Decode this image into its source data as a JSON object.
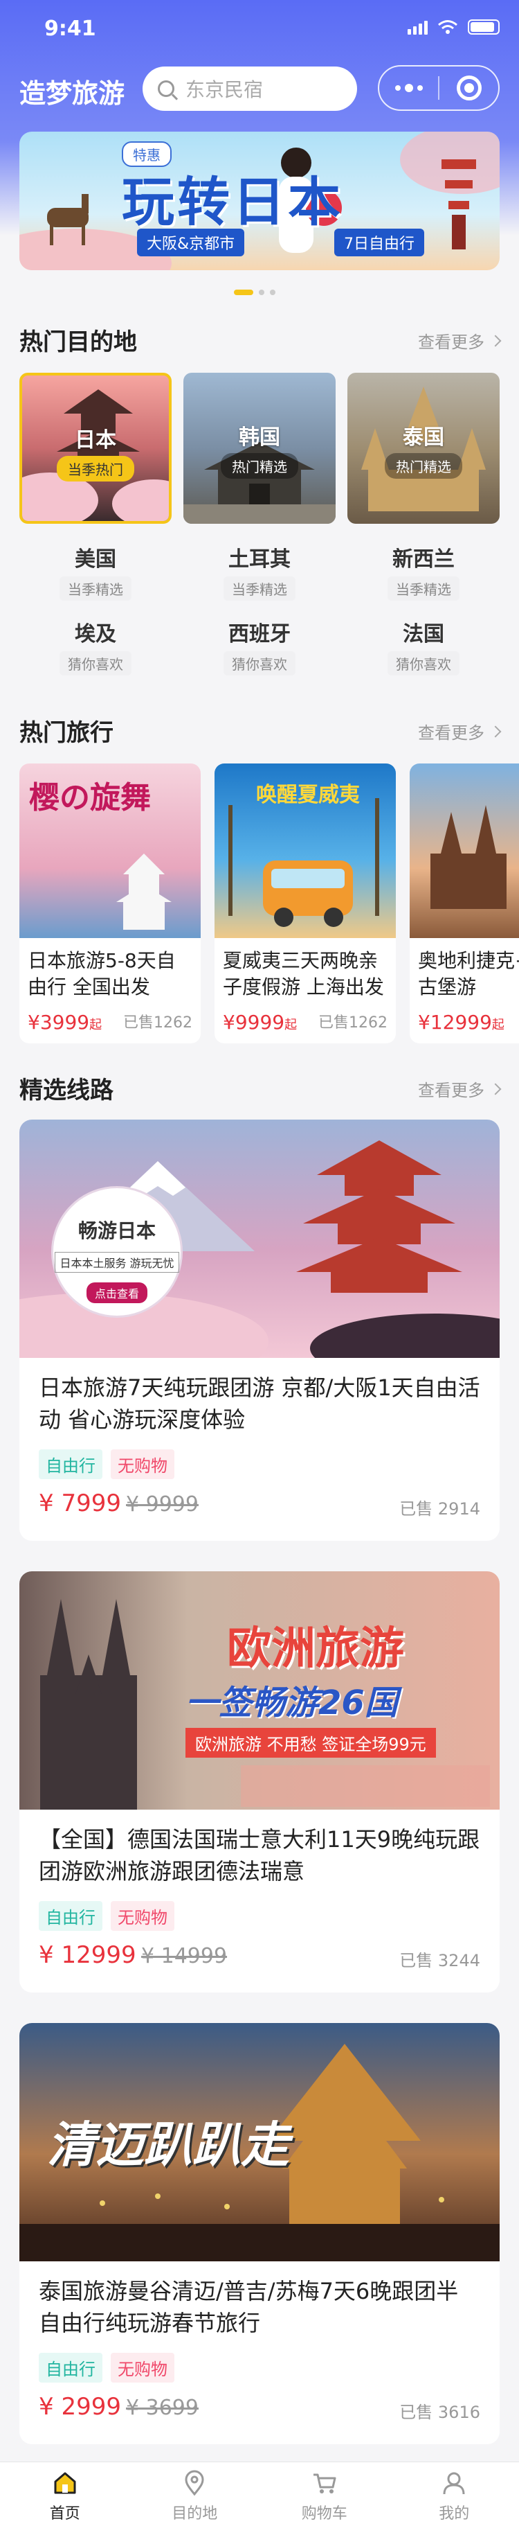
{
  "status": {
    "time": "9:41"
  },
  "header": {
    "brand": "造梦旅游",
    "search_placeholder": "东京民宿"
  },
  "banner": {
    "tag": "特惠",
    "title": "玩转日本",
    "pill_left": "大阪&京都市",
    "pill_right": "7日自由行"
  },
  "hot_dest": {
    "title": "热门目的地",
    "more": "查看更多",
    "featured": [
      {
        "name": "日本",
        "badge": "当季热门"
      },
      {
        "name": "韩国",
        "badge": "热门精选"
      },
      {
        "name": "泰国",
        "badge": "热门精选"
      }
    ],
    "grid": [
      {
        "name": "美国",
        "sub": "当季精选"
      },
      {
        "name": "土耳其",
        "sub": "当季精选"
      },
      {
        "name": "新西兰",
        "sub": "当季精选"
      },
      {
        "name": "埃及",
        "sub": "猜你喜欢"
      },
      {
        "name": "西班牙",
        "sub": "猜你喜欢"
      },
      {
        "name": "法国",
        "sub": "猜你喜欢"
      }
    ]
  },
  "hot_trips": {
    "title": "热门旅行",
    "more": "查看更多",
    "items": [
      {
        "title": "日本旅游5-8天自由行 全国出发",
        "price": "¥3999",
        "unit": "起",
        "sold": "已售1262",
        "art_title": "樱の旋舞"
      },
      {
        "title": "夏威夷三天两晚亲子度假游 上海出发",
        "price": "¥9999",
        "unit": "起",
        "sold": "已售1262",
        "art_title": "唤醒夏威夷"
      },
      {
        "title": "奥地利捷克+欧洲古堡游",
        "price": "¥12999",
        "unit": "起",
        "sold": ""
      }
    ]
  },
  "routes": {
    "title": "精选线路",
    "more": "查看更多",
    "items": [
      {
        "title": "日本旅游7天纯玩跟团游 京都/大阪1天自由活动 省心游玩深度体验",
        "tags": [
          "自由行",
          "无购物"
        ],
        "price": "¥ 7999",
        "old": "¥ 9999",
        "sold": "已售 2914",
        "art_title": "畅游日本",
        "art_sub": "日本本土服务 游玩无忧",
        "art_btn": "点击查看"
      },
      {
        "title": "【全国】德国法国瑞士意大利11天9晚纯玩跟团游欧洲旅游跟团德法瑞意",
        "tags": [
          "自由行",
          "无购物"
        ],
        "price": "¥ 12999",
        "old": "¥ 14999",
        "sold": "已售 3244",
        "art_title": "欧洲旅游",
        "art_sub": "一签畅游26国",
        "art_note": "欧洲旅游 不用愁 签证全场99元"
      },
      {
        "title": "泰国旅游曼谷清迈/普吉/苏梅7天6晚跟团半自由行纯玩游春节旅行",
        "tags": [
          "自由行",
          "无购物"
        ],
        "price": "¥ 2999",
        "old": "¥ 3699",
        "sold": "已售 3616",
        "art_title": "清迈趴趴走"
      }
    ]
  },
  "tabbar": [
    {
      "label": "首页",
      "icon": "home-icon",
      "active": true
    },
    {
      "label": "目的地",
      "icon": "location-icon",
      "active": false
    },
    {
      "label": "购物车",
      "icon": "cart-icon",
      "active": false
    },
    {
      "label": "我的",
      "icon": "user-icon",
      "active": false
    }
  ]
}
